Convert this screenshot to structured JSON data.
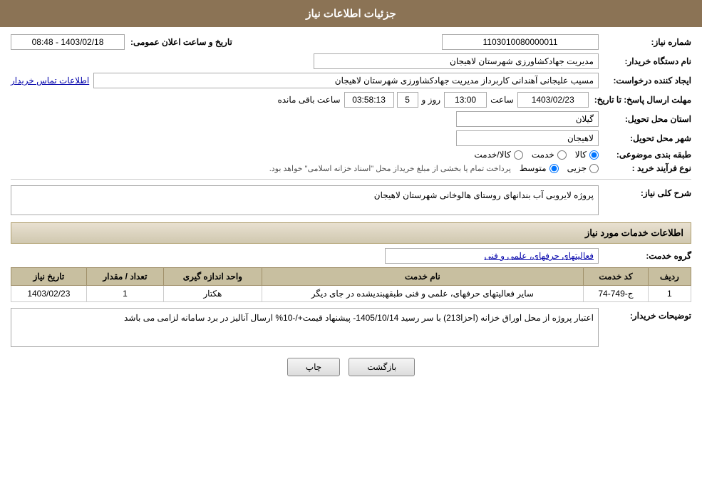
{
  "header": {
    "title": "جزئیات اطلاعات نیاز"
  },
  "fields": {
    "shomare_niaz_label": "شماره نیاز:",
    "shomare_niaz_value": "1103010080000011",
    "nam_dastgah_label": "نام دستگاه خریدار:",
    "nam_dastgah_value": "مدیریت جهادکشاورزی شهرستان لاهیجان",
    "tarikh_label": "تاریخ و ساعت اعلان عمومی:",
    "tarikh_from": "1403/02/18 - 08:48",
    "ijad_label": "ایجاد کننده درخواست:",
    "ijad_value": "مسیب علیجانی آهندانی کاربرداز مدیریت جهادکشاورزی شهرستان لاهیجان",
    "ettelaat_link": "اطلاعات تماس خریدار",
    "mohlat_label": "مهلت ارسال پاسخ: تا تاریخ:",
    "mohlat_date": "1403/02/23",
    "mohlat_saat": "13:00",
    "mohlat_roz": "5",
    "mohlat_time": "03:58:13",
    "mohlat_mande": "ساعت باقی مانده",
    "ostan_label": "استان محل تحویل:",
    "ostan_value": "گیلان",
    "shahr_label": "شهر محل تحویل:",
    "shahr_value": "لاهیجان",
    "tabaqe_label": "طبقه بندی موضوعی:",
    "tabaqe_options": [
      "کالا",
      "خدمت",
      "کالا/خدمت"
    ],
    "tabaqe_selected": "کالا",
    "noe_label": "نوع فرآیند خرید :",
    "noe_options": [
      "جزیی",
      "متوسط"
    ],
    "noe_note": "پرداخت تمام یا بخشی از مبلغ خریداز محل \"اسناد خزانه اسلامی\" خواهد بود.",
    "sharh_label": "شرح کلی نیاز:",
    "sharh_value": "پروژه لایروبی آب بندانهای روستای هالوخانی شهرستان لاهیجان",
    "khadamat_header": "اطلاعات خدمات مورد نیاز",
    "grouh_label": "گروه خدمت:",
    "grouh_value": "فعالیتهای حرفهای، علمی و فنی",
    "table": {
      "headers": [
        "ردیف",
        "کد خدمت",
        "نام خدمت",
        "واحد اندازه گیری",
        "تعداد / مقدار",
        "تاریخ نیاز"
      ],
      "rows": [
        {
          "radif": "1",
          "kod": "ج-749-74",
          "name": "سایر فعالیتهای حرفهای، علمی و فنی طبقهبندیشده در جای دیگر",
          "vahed": "هکتار",
          "tedad": "1",
          "tarikh": "1403/02/23"
        }
      ]
    },
    "tozihat_label": "توضیحات خریدار:",
    "tozihat_value": "اعتبار پروژه از محل اوراق خزانه (احزا213) با سر رسید 1405/10/14- پیشنهاد قیمت+/-10% ارسال آنالیز در برد سامانه لزامی می باشد"
  },
  "buttons": {
    "chap": "چاپ",
    "bazgasht": "بازگشت"
  }
}
